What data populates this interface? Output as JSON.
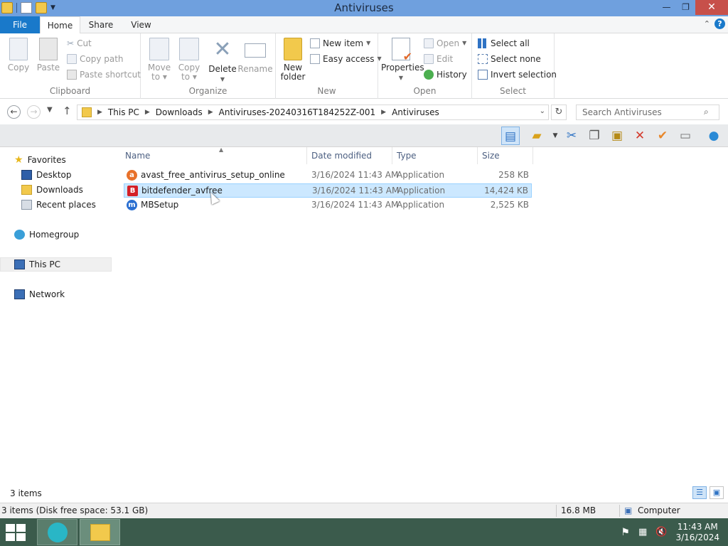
{
  "window": {
    "title": "Antiviruses",
    "min_glyph": "—",
    "restore_glyph": "❐",
    "close_glyph": "✕"
  },
  "ribbon_tabs": [
    "File",
    "Home",
    "Share",
    "View"
  ],
  "help_glyph": "?",
  "ribbon": {
    "clipboard": {
      "label": "Clipboard",
      "copy": "Copy",
      "paste": "Paste",
      "cut": "Cut",
      "copy_path": "Copy path",
      "paste_shortcut": "Paste shortcut"
    },
    "organize": {
      "label": "Organize",
      "move_to": [
        "Move",
        "to ▾"
      ],
      "copy_to": [
        "Copy",
        "to ▾"
      ],
      "delete": "Delete",
      "rename": "Rename"
    },
    "new": {
      "label": "New",
      "new_folder": [
        "New",
        "folder"
      ],
      "new_item": "New item",
      "easy_access": "Easy access"
    },
    "open": {
      "label": "Open",
      "properties": "Properties",
      "open": "Open",
      "edit": "Edit",
      "history": "History"
    },
    "select": {
      "label": "Select",
      "select_all": "Select all",
      "select_none": "Select none",
      "invert_selection": "Invert selection"
    }
  },
  "address": {
    "crumbs": [
      "This PC",
      "Downloads",
      "Antiviruses-20240316T184252Z-001",
      "Antiviruses"
    ],
    "search_placeholder": "Search Antiviruses"
  },
  "nav": {
    "favorites": "Favorites",
    "desktop": "Desktop",
    "downloads": "Downloads",
    "recent_places": "Recent places",
    "homegroup": "Homegroup",
    "this_pc": "This PC",
    "network": "Network"
  },
  "columns": {
    "name": "Name",
    "date_modified": "Date modified",
    "type": "Type",
    "size": "Size"
  },
  "files": [
    {
      "name": "avast_free_antivirus_setup_online",
      "date": "3/16/2024 11:43 AM",
      "type": "Application",
      "size": "258 KB",
      "icon_color": "#e8712a",
      "icon_glyph": "a"
    },
    {
      "name": "bitdefender_avfree",
      "date": "3/16/2024 11:43 AM",
      "type": "Application",
      "size": "14,424 KB",
      "icon_color": "#d42027",
      "icon_glyph": "B"
    },
    {
      "name": "MBSetup",
      "date": "3/16/2024 11:43 AM",
      "type": "Application",
      "size": "2,525 KB",
      "icon_color": "#2a6fd1",
      "icon_glyph": "m"
    }
  ],
  "item_count": "3 items",
  "status": {
    "left": "3 items (Disk free space: 53.1 GB)",
    "size": "16.8 MB",
    "location": "Computer"
  },
  "taskbar": {
    "time": "11:43 AM",
    "date": "3/16/2024"
  }
}
